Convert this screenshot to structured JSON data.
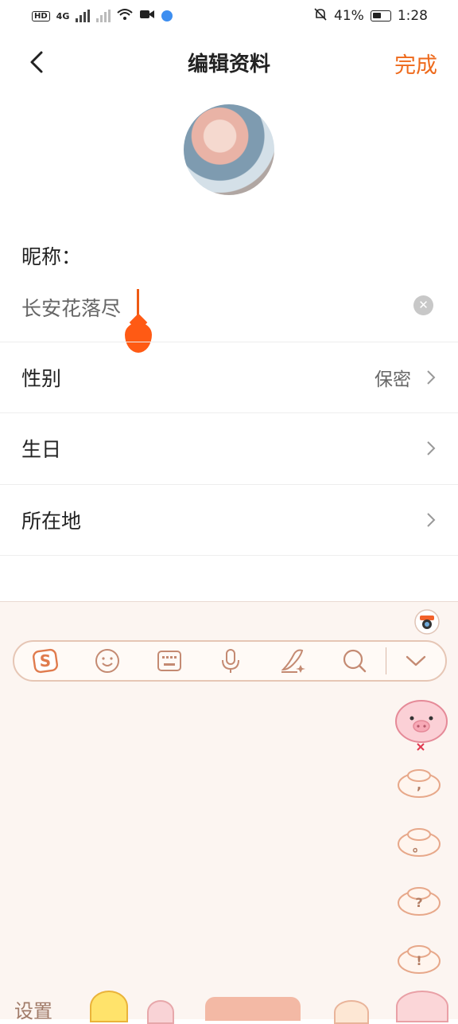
{
  "status_bar": {
    "left_icons": [
      "hd-icon",
      "4g-signal-icon",
      "signal-icon",
      "wifi-icon",
      "video-icon",
      "app-dot-icon"
    ],
    "hd_label": "HD",
    "net_label": "4G",
    "battery_percent": "41%",
    "time": "1:28"
  },
  "header": {
    "title": "编辑资料",
    "done_label": "完成"
  },
  "profile": {
    "nickname_label": "昵称：",
    "nickname_value": "长安花落尽"
  },
  "rows": [
    {
      "label": "性别",
      "value": "保密"
    },
    {
      "label": "生日",
      "value": ""
    },
    {
      "label": "所在地",
      "value": ""
    }
  ],
  "keyboard": {
    "toolbar_icons": [
      "sogou-logo-icon",
      "emoji-icon",
      "keyboard-icon",
      "microphone-icon",
      "handwriting-icon",
      "search-icon",
      "collapse-keyboard-icon"
    ],
    "side_keys": [
      ",",
      "。",
      "?",
      "!"
    ],
    "settings_label": "设置",
    "colors": {
      "background": "#fcf5f1",
      "stroke": "#e6c6b5"
    }
  },
  "colors": {
    "accent": "#ee6a1c",
    "cursor": "#ff5a14"
  }
}
